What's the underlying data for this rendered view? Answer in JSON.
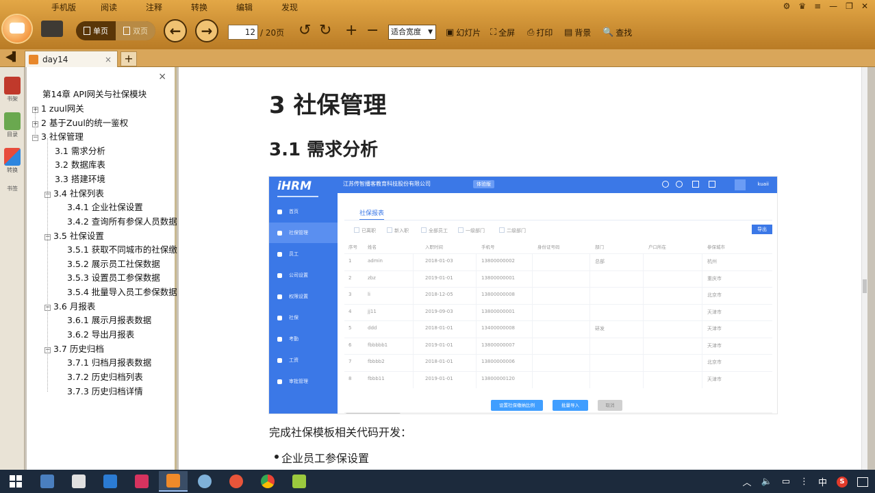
{
  "menu": [
    "手机版",
    "阅读",
    "注释",
    "转换",
    "编辑",
    "发现"
  ],
  "toolbar": {
    "view_single": "单页",
    "view_double": "双页",
    "page_current": "12",
    "page_total": "/ 20页",
    "zoom": "适合宽度",
    "slideshow": "幻灯片",
    "fullscreen": "全屏",
    "print": "打印",
    "background": "背景",
    "find": "查找"
  },
  "tab": {
    "title": "day14",
    "close": "×",
    "add": "+"
  },
  "sidebar": {
    "bookshelf": "书架",
    "outline": "目录",
    "convert": "转换",
    "bookmark": "书签"
  },
  "outline": {
    "close": "×",
    "items": [
      "第14章 API网关与社保模块",
      "1 zuul网关",
      "2 基于Zuul的统一鉴权",
      "3 社保管理",
      "3.1 需求分析",
      "3.2 数据库表",
      "3.3 搭建环境",
      "3.4 社保列表",
      "3.4.1 企业社保设置",
      "3.4.2 查询所有参保人员数据",
      "3.5 社保设置",
      "3.5.1 获取不同城市的社保缴",
      "3.5.2 展示员工社保数据",
      "3.5.3 设置员工参保数据",
      "3.5.4 批量导入员工参保数据",
      "3.6 月报表",
      "3.6.1 展示月报表数据",
      "3.6.2 导出月报表",
      "3.7 历史归档",
      "3.7.1 归档月报表数据",
      "3.7.2 历史归档列表",
      "3.7.3 历史归档详情"
    ]
  },
  "document": {
    "h1": "3 社保管理",
    "h2": "3.1 需求分析",
    "paragraph": "完成社保模板相关代码开发：",
    "bullet": "企业员工参保设置"
  },
  "screenshot": {
    "logo": "iHRM",
    "company": "江苏传智播客教育科技股份有限公司",
    "badge": "体验版",
    "user": "kuaii",
    "tab": "社保报表",
    "action_btn": "导出",
    "nav": [
      "首页",
      "社保管理",
      "员工",
      "公司设置",
      "权限设置",
      "社保",
      "考勤",
      "工资",
      "审批管理"
    ],
    "filters": [
      "已离职",
      "新入职",
      "全部员工",
      "一级部门",
      "二级部门"
    ],
    "headers": [
      "序号",
      "姓名",
      "入职时间",
      "手机号",
      "身份证号码",
      "部门",
      "户口所在",
      "参保城市"
    ],
    "rows": [
      [
        "1",
        "admin",
        "2018-01-03",
        "13800000002",
        "",
        "总部",
        "",
        "杭州"
      ],
      [
        "2",
        "zbz",
        "2019-01-01",
        "13800000001",
        "",
        "",
        "",
        "重庆市"
      ],
      [
        "3",
        "li",
        "2018-12-05",
        "13800000008",
        "",
        "",
        "",
        "北京市"
      ],
      [
        "4",
        "jj11",
        "2019-09-03",
        "13800000001",
        "",
        "",
        "",
        "天津市"
      ],
      [
        "5",
        "ddd",
        "2018-01-01",
        "13400000008",
        "",
        "研发",
        "",
        "天津市"
      ],
      [
        "6",
        "fbbbbb1",
        "2019-01-01",
        "13800000007",
        "",
        "",
        "",
        "天津市"
      ],
      [
        "7",
        "fbbbb2",
        "2018-01-01",
        "13800000006",
        "",
        "",
        "",
        "北京市"
      ],
      [
        "8",
        "fbbb11",
        "2019-01-01",
        "13800000120",
        "",
        "",
        "",
        "天津市"
      ]
    ],
    "buttons": [
      "设置社保缴纳比例",
      "批量导入",
      "取消"
    ]
  },
  "taskbar": {
    "ime": "中",
    "notification": "通知"
  }
}
